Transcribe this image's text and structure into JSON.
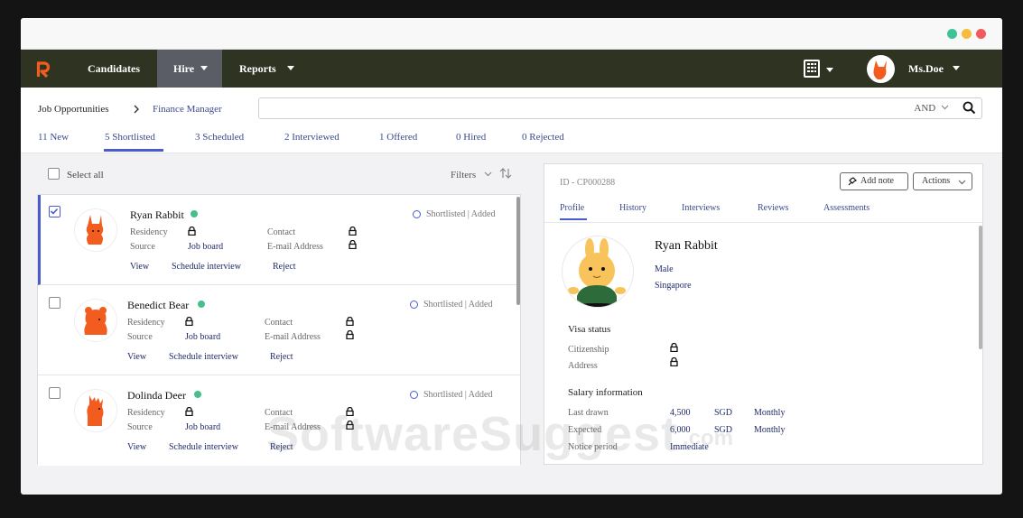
{
  "window": {
    "dots": [
      "#3dc394",
      "#f5bd3b",
      "#f15b5b"
    ]
  },
  "nav": {
    "items": [
      {
        "label": "Candidates",
        "active": false
      },
      {
        "label": "Hire",
        "active": true
      },
      {
        "label": "Reports",
        "active": false
      }
    ],
    "user": "Ms.Doe",
    "brand_color": "#f25c1e",
    "bar_color": "#2f3322"
  },
  "breadcrumb": {
    "root": "Job Opportunities",
    "current": "Finance Manager"
  },
  "search": {
    "placeholder": "",
    "operator": "AND"
  },
  "tabs": [
    {
      "label": "11 New",
      "active": false
    },
    {
      "label": "5 Shortlisted",
      "active": true
    },
    {
      "label": "3 Scheduled",
      "active": false
    },
    {
      "label": "2 Interviewed",
      "active": false
    },
    {
      "label": "1 Offered",
      "active": false
    },
    {
      "label": "0 Hired",
      "active": false
    },
    {
      "label": "0 Rejected",
      "active": false
    }
  ],
  "list_toolbar": {
    "select_all": "Select all",
    "filters": "Filters"
  },
  "candidates": [
    {
      "name": "Ryan Rabbit",
      "selected": true,
      "online": true,
      "status": "Shortlisted | Added",
      "residency_label": "Residency",
      "source_label": "Source",
      "source": "Job board",
      "contact_label": "Contact",
      "email_label": "E-mail Address",
      "actions": [
        "View",
        "Schedule interview",
        "Reject"
      ]
    },
    {
      "name": "Benedict Bear",
      "selected": false,
      "online": true,
      "status": "Shortlisted | Added",
      "residency_label": "Residency",
      "source_label": "Source",
      "source": "Job board",
      "contact_label": "Contact",
      "email_label": "E-mail Address",
      "actions": [
        "View",
        "Schedule interview",
        "Reject"
      ]
    },
    {
      "name": "Dolinda Deer",
      "selected": false,
      "online": true,
      "status": "Shortlisted | Added",
      "residency_label": "Residency",
      "source_label": "Source",
      "source": "Job board",
      "contact_label": "Contact",
      "email_label": "E-mail Address",
      "actions": [
        "View",
        "Schedule interview",
        "Reject"
      ]
    }
  ],
  "detail": {
    "id": "ID - CP000288",
    "add_note": "Add note",
    "actions": "Actions",
    "tabs": [
      "Profile",
      "History",
      "Interviews",
      "Reviews",
      "Assessments"
    ],
    "name": "Ryan Rabbit",
    "gender": "Male",
    "location": "Singapore",
    "visa_title": "Visa status",
    "citizenship_label": "Citizenship",
    "address_label": "Address",
    "salary_title": "Salary information",
    "salary_rows": [
      {
        "label": "Last drawn",
        "amount": "4,500",
        "currency": "SGD",
        "period": "Monthly"
      },
      {
        "label": "Expected",
        "amount": "6,000",
        "currency": "SGD",
        "period": "Monthly"
      }
    ],
    "notice_label": "Notice period",
    "notice_value": "Immediate"
  },
  "watermark": {
    "text": "SoftwareSuggest",
    "suffix": ".com"
  }
}
